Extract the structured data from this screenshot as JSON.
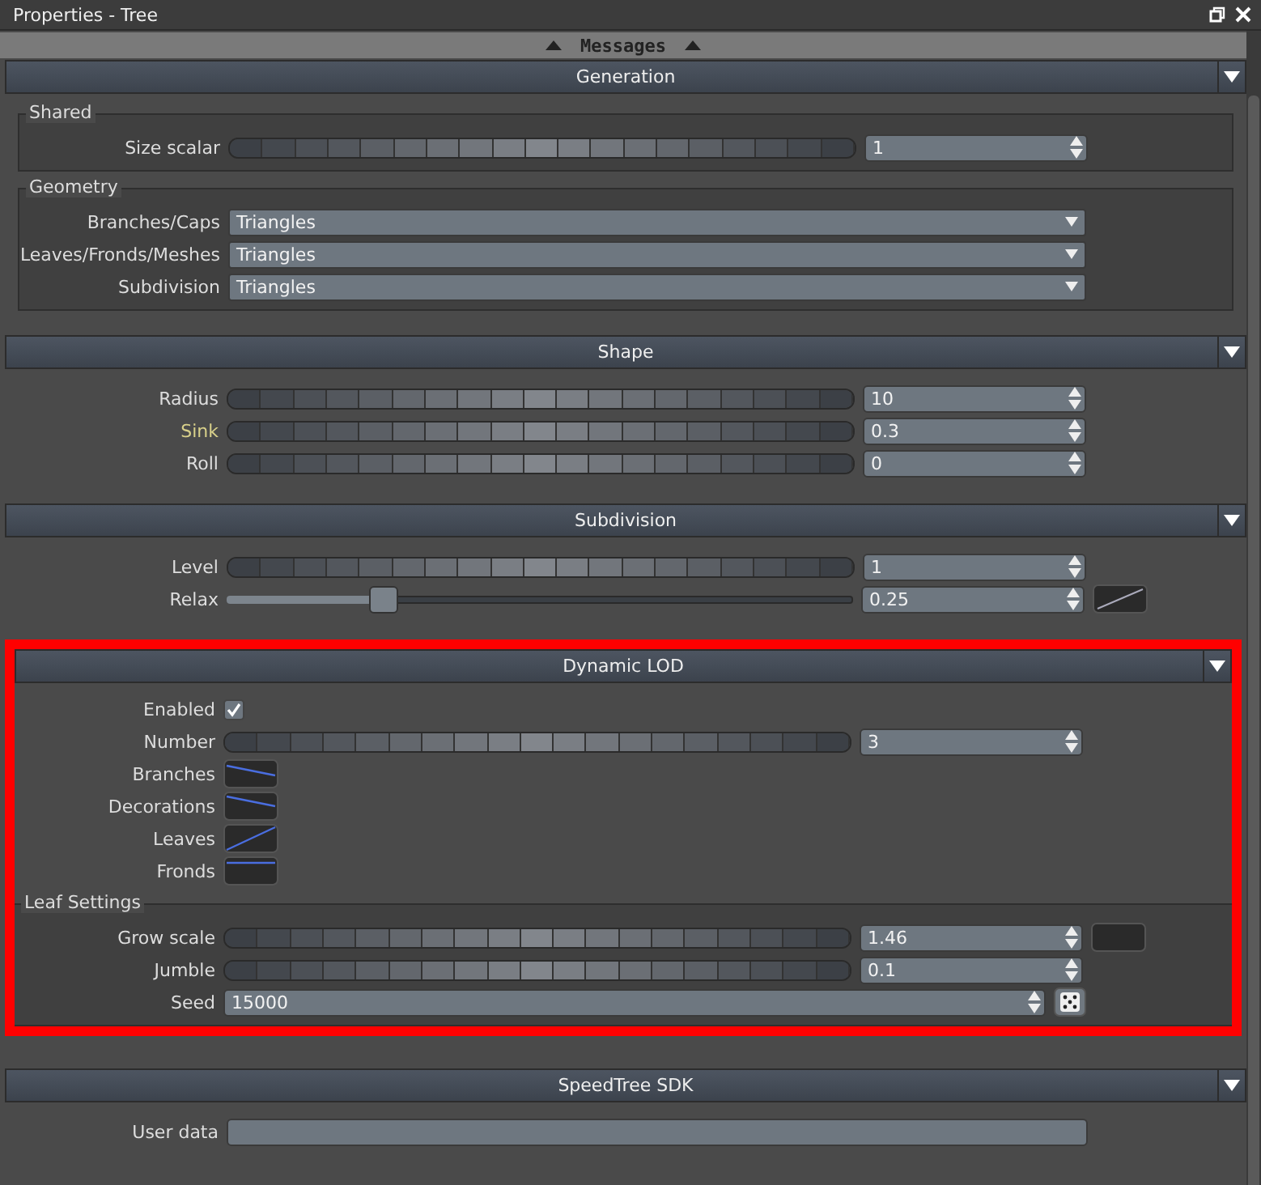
{
  "window": {
    "title": "Properties - Tree"
  },
  "messages_bar": {
    "label": "Messages"
  },
  "sections": [
    {
      "title": "Generation",
      "expanded": true,
      "highlighted": false,
      "groups": [
        {
          "title": "Shared",
          "rows": [
            {
              "kind": "scrub",
              "label": "Size scalar",
              "value": "1",
              "modified": false,
              "curve": false
            }
          ]
        },
        {
          "title": "Geometry",
          "rows": [
            {
              "kind": "dropdown",
              "label": "Branches/Caps",
              "value": "Triangles",
              "modified": false
            },
            {
              "kind": "dropdown",
              "label": "Leaves/Fronds/Meshes",
              "value": "Triangles",
              "modified": false
            },
            {
              "kind": "dropdown",
              "label": "Subdivision",
              "value": "Triangles",
              "modified": false
            }
          ]
        }
      ]
    },
    {
      "title": "Shape",
      "expanded": true,
      "highlighted": false,
      "groups": [
        {
          "rows": [
            {
              "kind": "scrub",
              "label": "Radius",
              "value": "10",
              "modified": false,
              "curve": false
            },
            {
              "kind": "scrub",
              "label": "Sink",
              "value": "0.3",
              "modified": true,
              "curve": false
            },
            {
              "kind": "scrub",
              "label": "Roll",
              "value": "0",
              "modified": false,
              "curve": false
            }
          ]
        }
      ]
    },
    {
      "title": "Subdivision",
      "expanded": true,
      "highlighted": false,
      "groups": [
        {
          "rows": [
            {
              "kind": "scrub",
              "label": "Level",
              "value": "1",
              "modified": false,
              "curve": false
            },
            {
              "kind": "slider",
              "label": "Relax",
              "value": "0.25",
              "level": 0.25,
              "modified": false,
              "curve": true
            }
          ]
        }
      ]
    },
    {
      "title": "Dynamic LOD",
      "expanded": true,
      "highlighted": true,
      "groups": [
        {
          "rows": [
            {
              "kind": "checkbox",
              "label": "Enabled",
              "checked": true,
              "modified": false
            },
            {
              "kind": "scrub",
              "label": "Number",
              "value": "3",
              "modified": false,
              "curve": false
            },
            {
              "kind": "curve",
              "label": "Branches",
              "modified": false
            },
            {
              "kind": "curve",
              "label": "Decorations",
              "modified": false
            },
            {
              "kind": "curve",
              "label": "Leaves",
              "modified": false
            },
            {
              "kind": "curve",
              "label": "Fronds",
              "modified": false
            }
          ]
        },
        {
          "title": "Leaf Settings",
          "rows": [
            {
              "kind": "scrub",
              "label": "Grow scale",
              "value": "1.46",
              "modified": false,
              "curve": true
            },
            {
              "kind": "scrub",
              "label": "Jumble",
              "value": "0.1",
              "modified": false,
              "curve": false
            },
            {
              "kind": "seed",
              "label": "Seed",
              "value": "15000",
              "modified": false
            }
          ]
        }
      ]
    },
    {
      "title": "SpeedTree SDK",
      "expanded": true,
      "highlighted": false,
      "groups": [
        {
          "rows": [
            {
              "kind": "text",
              "label": "User data",
              "value": "",
              "modified": false
            }
          ]
        }
      ]
    }
  ]
}
